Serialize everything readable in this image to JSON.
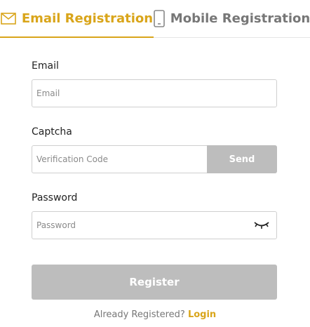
{
  "tabs": {
    "email": {
      "label": "Email Registration",
      "icon": "mail-icon",
      "active": true
    },
    "mobile": {
      "label": "Mobile Registration",
      "icon": "phone-icon",
      "active": false
    }
  },
  "form": {
    "email": {
      "label": "Email",
      "placeholder": "Email",
      "value": ""
    },
    "captcha": {
      "label": "Captcha",
      "placeholder": "Verification Code",
      "value": "",
      "send_label": "Send"
    },
    "password": {
      "label": "Password",
      "placeholder": "Password",
      "value": "",
      "toggle_icon": "eye-closed-icon"
    },
    "register_label": "Register"
  },
  "footer": {
    "prompt": "Already Registered?",
    "login_label": "Login"
  },
  "colors": {
    "accent": "#d9a51a",
    "disabled_button": "#bdbdbd",
    "inactive_tab": "#777777"
  }
}
